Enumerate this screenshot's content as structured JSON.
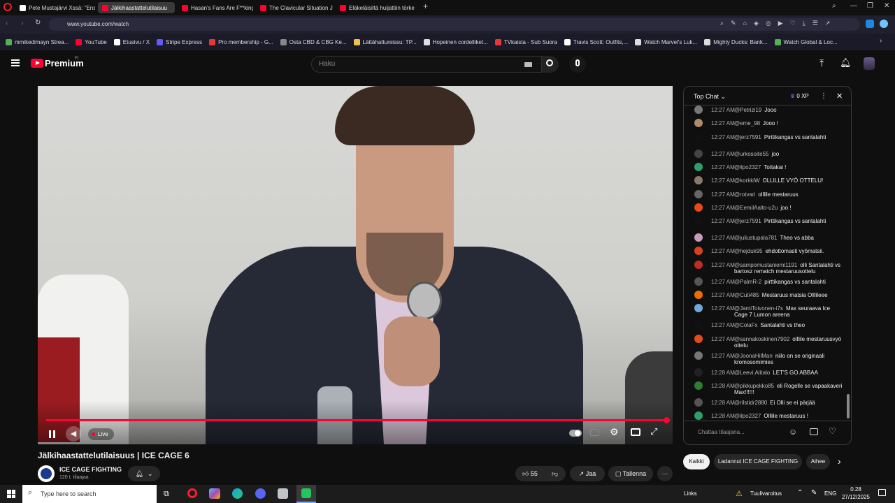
{
  "browser": {
    "tabs": [
      {
        "title": "Pete Mustajärvi Xssä: \"Ens",
        "color": "#ffffff"
      },
      {
        "title": "Jälkihaastattelutilaisuu",
        "color": "#ff0033",
        "active": true
      },
      {
        "title": "Hasan's Fans Are F**king",
        "color": "#ff0033"
      },
      {
        "title": "The Clavicular Situation Ju",
        "color": "#ff0033"
      },
      {
        "title": "Eläkeläisiltä huijattiin törke",
        "color": "#ff0033"
      }
    ],
    "url": "www.youtube.com/watch",
    "bookmarks": [
      {
        "label": "mmikedimayn Strea...",
        "color": "#53b14e"
      },
      {
        "label": "YouTube",
        "color": "#ff0033"
      },
      {
        "label": "Etusivu / X",
        "color": "#ffffff"
      },
      {
        "label": "Stripe Express",
        "color": "#635bff"
      },
      {
        "label": "Pro membership - G...",
        "color": "#e53935"
      },
      {
        "label": "Osta CBD & CBG Ke...",
        "color": "#888888"
      },
      {
        "label": "Lättähattureissu: TP...",
        "color": "#f0c24b"
      },
      {
        "label": "Hopeinen cordelliket...",
        "color": "#dddddd"
      },
      {
        "label": "TVkaista - Sub Suora",
        "color": "#e53935"
      },
      {
        "label": "Travis Scott: Outfits,...",
        "color": "#ffffff"
      },
      {
        "label": "Watch Marvel's Luk...",
        "color": "#dddddd"
      },
      {
        "label": "Mighty Ducks: Bank...",
        "color": "#dddddd"
      },
      {
        "label": "Watch Global & Loc...",
        "color": "#53b14e"
      }
    ]
  },
  "youtube": {
    "logo_text": "Premium",
    "logo_sup": "FI",
    "search_placeholder": "Haku"
  },
  "player": {
    "live_label": "Live",
    "progress": 1.0,
    "accent": "#ff0033"
  },
  "video": {
    "title": "Jälkihaastattelutilaisuus | ICE CAGE 6",
    "channel": "ICE CAGE FIGHTING",
    "subs": "120 t. tilaajaa",
    "likes": "55",
    "share_label": "Jaa",
    "save_label": "Tallenna"
  },
  "chat": {
    "header": "Top Chat",
    "xp": "0 XP",
    "input_placeholder": "Chattaa tilaajana...",
    "messages": [
      {
        "time": "12:27 AM",
        "author": "@Petrizi19",
        "text": "Jooo",
        "color": "#777777"
      },
      {
        "time": "12:27 AM",
        "author": "@eme_98",
        "text": "Jooo !",
        "color": "#b08968"
      },
      {
        "time": "12:27 AM",
        "author": "@jerz7591",
        "text": "Pirttikangas vs santalahti",
        "color": "#111111"
      },
      {
        "time": "12:27 AM",
        "author": "@urkosoite55",
        "text": "joo",
        "color": "#444444"
      },
      {
        "time": "12:27 AM",
        "author": "@ilpo2327",
        "text": "Tottakai !",
        "color": "#2e9e6a"
      },
      {
        "time": "12:27 AM",
        "author": "@korkkiW",
        "text": "OLLILLE VYÖ OTTELU!",
        "color": "#8a7a6a"
      },
      {
        "time": "12:27 AM",
        "author": "@rotvari",
        "text": "olllile mestaruus",
        "color": "#666666"
      },
      {
        "time": "12:27 AM",
        "author": "@EemilAalto-u2u",
        "text": "joo !",
        "color": "#e64a19"
      },
      {
        "time": "12:27 AM",
        "author": "@jerz7591",
        "text": "Pirttikangas vs santalahti",
        "color": "#111111"
      },
      {
        "time": "12:27 AM",
        "author": "@juliustupala781",
        "text": "Theo vs abba",
        "color": "#c79ac0"
      },
      {
        "time": "12:27 AM",
        "author": "@hejduk95",
        "text": "ehdottomasti vyömatsii.",
        "color": "#d84315"
      },
      {
        "time": "12:27 AM",
        "author": "@sampomustaniemi1191",
        "text": "olli Santalahti vs bartosz rematch mestaruusottelu",
        "color": "#c62828"
      },
      {
        "time": "12:27 AM",
        "author": "@PalmR-2",
        "text": "pirttikangas vs santalahti",
        "color": "#555555"
      },
      {
        "time": "12:27 AM",
        "author": "@Cuti485",
        "text": "Mestaruus matsia Olllileee",
        "color": "#ef6c00"
      },
      {
        "time": "12:27 AM",
        "author": "@JamiToivonen-i7s",
        "text": "Max seuraava Ice Cage 7 Lumon areena",
        "color": "#6fa8dc"
      },
      {
        "time": "12:27 AM",
        "author": "@ColaFx",
        "text": "Santalahti vs theo",
        "color": "#111111"
      },
      {
        "time": "12:27 AM",
        "author": "@sannakoskinen7902",
        "text": "olllile mestaruusvyö ottelu",
        "color": "#e64a19"
      },
      {
        "time": "12:27 AM",
        "author": "@JoonaHilMan",
        "text": "niilo on se originaali kromosomimies",
        "color": "#777777"
      },
      {
        "time": "12:28 AM",
        "author": "@Leevi.Alitalo",
        "text": "LET'S GO ABBAA",
        "color": "#222222"
      },
      {
        "time": "12:28 AM",
        "author": "@pikkupekko85",
        "text": "eli Rogelle se vapaakaveri Max!!!!!!",
        "color": "#2e7d32"
      },
      {
        "time": "12:28 AM",
        "author": "@rilstidr2880",
        "text": "Ei Olli se ei pärjää",
        "color": "#555555"
      },
      {
        "time": "12:28 AM",
        "author": "@ilpo2327",
        "text": "Olllile mestaruus !",
        "color": "#2e9e6a"
      }
    ]
  },
  "chips": {
    "all": "Kaikki",
    "uploaded": "Ladannut ICE CAGE FIGHTING",
    "related": "Aihee"
  },
  "taskbar": {
    "search_placeholder": "Type here to search",
    "links": "Links",
    "weather": "Tuulivaroitus",
    "lang": "ENG",
    "time": "0.28",
    "date": "27/12/2025"
  }
}
